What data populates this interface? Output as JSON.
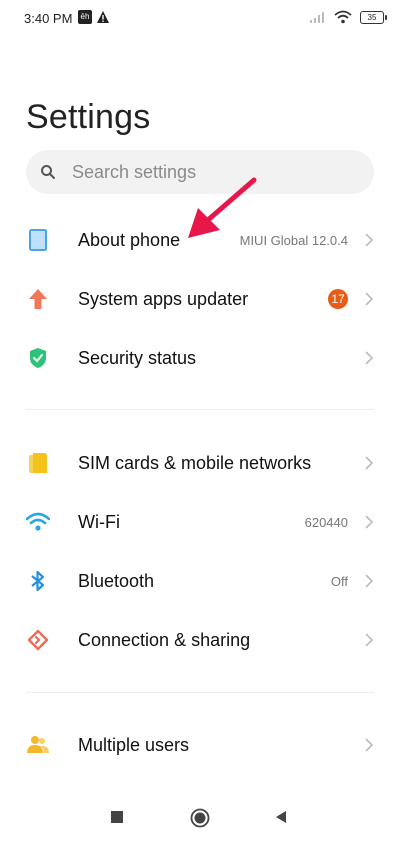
{
  "status_bar": {
    "time": "3:40 PM",
    "app_badge": "ēh",
    "battery": "35"
  },
  "title": "Settings",
  "search": {
    "placeholder": "Search settings"
  },
  "items": [
    {
      "id": "about-phone",
      "label": "About phone",
      "value": "MIUI Global 12.0.4",
      "icon": "phone-icon",
      "color": "#4aa3e6"
    },
    {
      "id": "system-apps-updater",
      "label": "System apps updater",
      "badge": "17",
      "icon": "arrow-up-icon",
      "color": "#f0775a"
    },
    {
      "id": "security-status",
      "label": "Security status",
      "icon": "shield-icon",
      "color": "#2ec37a"
    },
    {
      "id": "sim-cards",
      "label": "SIM cards & mobile networks",
      "icon": "sim-card-icon",
      "color": "#f5c21a"
    },
    {
      "id": "wifi",
      "label": "Wi-Fi",
      "value": "620440",
      "icon": "wifi-icon",
      "color": "#29a8e0"
    },
    {
      "id": "bluetooth",
      "label": "Bluetooth",
      "value": "Off",
      "icon": "bluetooth-icon",
      "color": "#2a8fe0"
    },
    {
      "id": "connection-sharing",
      "label": "Connection & sharing",
      "icon": "connection-sharing-icon",
      "color": "#f06a5a"
    },
    {
      "id": "multiple-users",
      "label": "Multiple users",
      "icon": "users-icon",
      "color": "#f5b82a"
    }
  ],
  "annotation_color": "#e8174a"
}
